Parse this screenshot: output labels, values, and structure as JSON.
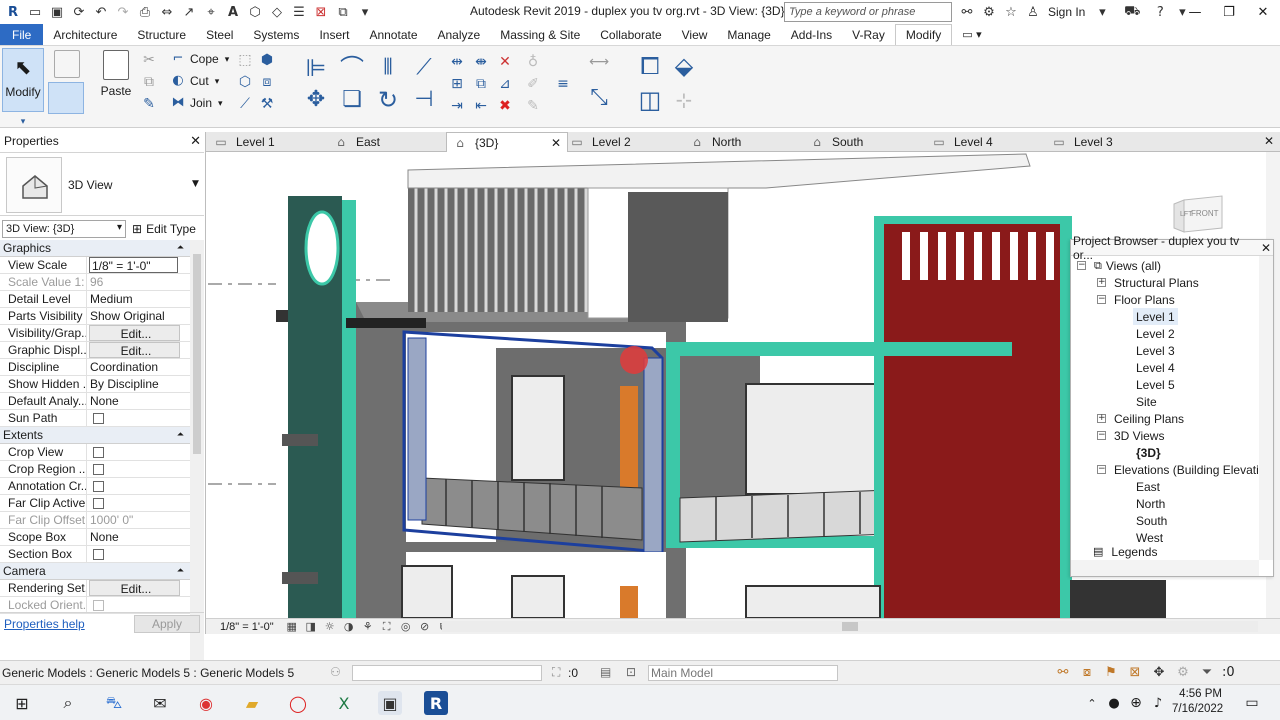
{
  "title_bar": {
    "document_title": "Autodesk Revit 2019 -  duplex  you tv org.rvt - 3D View: {3D}",
    "search_placeholder": "Type a keyword or phrase",
    "sign_in": "Sign In"
  },
  "ribbon_tabs": [
    "File",
    "Architecture",
    "Structure",
    "Steel",
    "Systems",
    "Insert",
    "Annotate",
    "Analyze",
    "Massing & Site",
    "Collaborate",
    "View",
    "Manage",
    "Add-Ins",
    "V-Ray",
    "Modify"
  ],
  "ribbon": {
    "modify_label": "Modify",
    "paste_label": "Paste",
    "cope_label": "Cope",
    "cut_label": "Cut",
    "join_label": "Join"
  },
  "properties": {
    "title": "Properties",
    "type_name": "3D View",
    "instance_selector": "3D View: {3D}",
    "edit_type": "Edit Type",
    "sections": {
      "graphics": "Graphics",
      "extents": "Extents",
      "camera": "Camera"
    },
    "graphics_rows": [
      {
        "key": "View Scale",
        "value": "1/8\" = 1'-0\""
      },
      {
        "key": "Scale Value  1:",
        "value": "96"
      },
      {
        "key": "Detail Level",
        "value": "Medium"
      },
      {
        "key": "Parts Visibility",
        "value": "Show Original"
      },
      {
        "key": "Visibility/Grap...",
        "value": "Edit..."
      },
      {
        "key": "Graphic Displ...",
        "value": "Edit..."
      },
      {
        "key": "Discipline",
        "value": "Coordination"
      },
      {
        "key": "Show Hidden ...",
        "value": "By Discipline"
      },
      {
        "key": "Default Analy...",
        "value": "None"
      },
      {
        "key": "Sun Path",
        "value": ""
      }
    ],
    "extents_rows": [
      {
        "key": "Crop View",
        "value": ""
      },
      {
        "key": "Crop Region ...",
        "value": ""
      },
      {
        "key": "Annotation Cr...",
        "value": ""
      },
      {
        "key": "Far Clip Active",
        "value": ""
      },
      {
        "key": "Far Clip Offset",
        "value": "1000'  0\""
      },
      {
        "key": "Scope Box",
        "value": "None"
      },
      {
        "key": "Section Box",
        "value": ""
      }
    ],
    "camera_rows": [
      {
        "key": "Rendering Set...",
        "value": "Edit..."
      },
      {
        "key": "Locked Orient...",
        "value": ""
      }
    ],
    "help_link": "Properties help",
    "apply": "Apply"
  },
  "view_tabs": [
    {
      "label": "Level 1",
      "icon": "plan-view-icon"
    },
    {
      "label": "East",
      "icon": "elevation-view-icon"
    },
    {
      "label": "{3D}",
      "icon": "3d-view-icon",
      "active": true
    },
    {
      "label": "Level 2",
      "icon": "plan-view-icon"
    },
    {
      "label": "North",
      "icon": "elevation-view-icon"
    },
    {
      "label": "South",
      "icon": "elevation-view-icon"
    },
    {
      "label": "Level 4",
      "icon": "plan-view-icon"
    },
    {
      "label": "Level 3",
      "icon": "plan-view-icon"
    }
  ],
  "viewcube": {
    "left_face": "LFT",
    "front_face": "FRONT"
  },
  "project_browser": {
    "title": "Project Browser - duplex  you tv or...",
    "nodes": [
      {
        "label": "Views (all)",
        "depth": 0
      },
      {
        "label": "Structural Plans",
        "depth": 1
      },
      {
        "label": "Floor Plans",
        "depth": 1
      },
      {
        "label": "Level 1",
        "depth": 2,
        "selected": true
      },
      {
        "label": "Level 2",
        "depth": 2
      },
      {
        "label": "Level 3",
        "depth": 2
      },
      {
        "label": "Level 4",
        "depth": 2
      },
      {
        "label": "Level 5",
        "depth": 2
      },
      {
        "label": "Site",
        "depth": 2
      },
      {
        "label": "Ceiling Plans",
        "depth": 1
      },
      {
        "label": "3D Views",
        "depth": 1
      },
      {
        "label": "{3D}",
        "depth": 2,
        "bold": true
      },
      {
        "label": "Elevations (Building Elevation)",
        "depth": 1
      },
      {
        "label": "East",
        "depth": 2
      },
      {
        "label": "North",
        "depth": 2
      },
      {
        "label": "South",
        "depth": 2
      },
      {
        "label": "West",
        "depth": 2
      },
      {
        "label": "Legends",
        "depth": 0
      }
    ]
  },
  "view_control_bar": {
    "scale": "1/8\" = 1'-0\""
  },
  "status_bar": {
    "selection": "Generic Models : Generic Models 5 : Generic Models 5",
    "selection_count": ":0",
    "model": "Main Model",
    "filter_count": ":0"
  },
  "taskbar": {
    "time": "4:56 PM",
    "date": "7/16/2022"
  },
  "colors": {
    "file_tab": "#2d6bc4",
    "teal_frame": "#3cc8a8",
    "maroon_wall": "#8a1a1a",
    "selection_blue": "#1c3f9e"
  }
}
